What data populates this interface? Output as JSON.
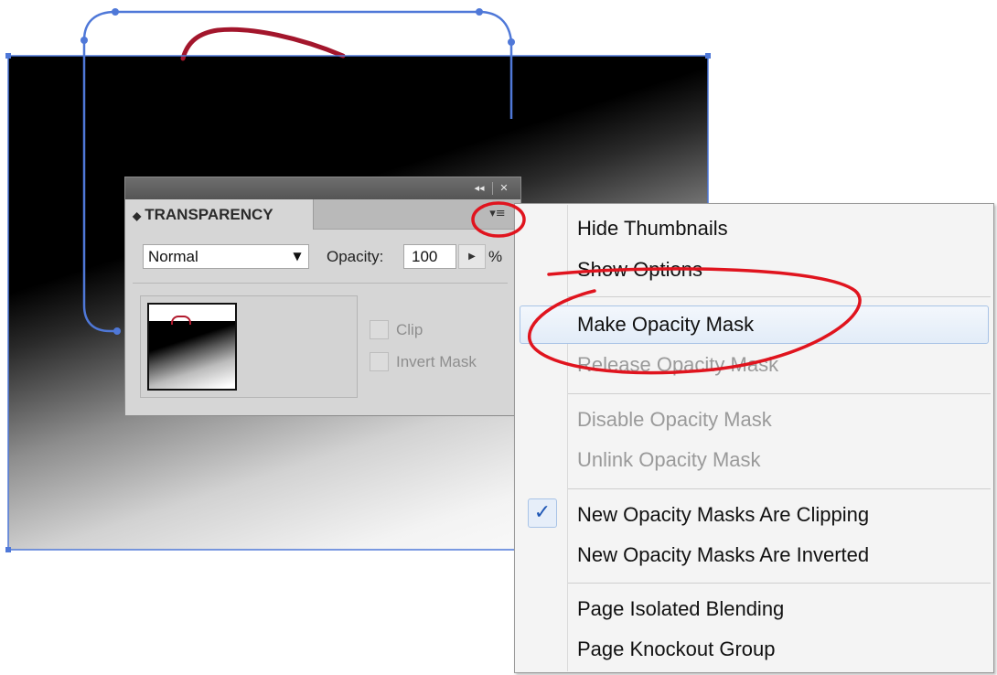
{
  "panel": {
    "title": "TRANSPARENCY",
    "tab_arrows": "◆",
    "collapse_glyph": "◂◂",
    "close_glyph": "✕",
    "menu_glyph": "▾≡",
    "blend_mode": "Normal",
    "dropdown_glyph": "▼",
    "opacity_label": "Opacity:",
    "opacity_value": "100",
    "opacity_stepper_glyph": "▶",
    "opacity_unit": "%",
    "clip_label": "Clip",
    "invert_mask_label": "Invert Mask"
  },
  "menu": {
    "items": [
      {
        "label": "Hide Thumbnails",
        "enabled": true
      },
      {
        "label": "Show Options",
        "enabled": true
      },
      {
        "label": "Make Opacity Mask",
        "enabled": true,
        "highlighted": true
      },
      {
        "label": "Release Opacity Mask",
        "enabled": false
      },
      {
        "label": "Disable Opacity Mask",
        "enabled": false
      },
      {
        "label": "Unlink Opacity Mask",
        "enabled": false
      },
      {
        "label": "New Opacity Masks Are Clipping",
        "enabled": true,
        "checked": true
      },
      {
        "label": "New Opacity Masks Are Inverted",
        "enabled": true
      },
      {
        "label": "Page Isolated Blending",
        "enabled": true
      },
      {
        "label": "Page Knockout Group",
        "enabled": true
      }
    ],
    "check_glyph": "✓"
  },
  "colors": {
    "selection": "#4f78d8",
    "annotation": "#e0141e",
    "path": "#a3162c",
    "menu_highlight": "#a8c3e6"
  }
}
